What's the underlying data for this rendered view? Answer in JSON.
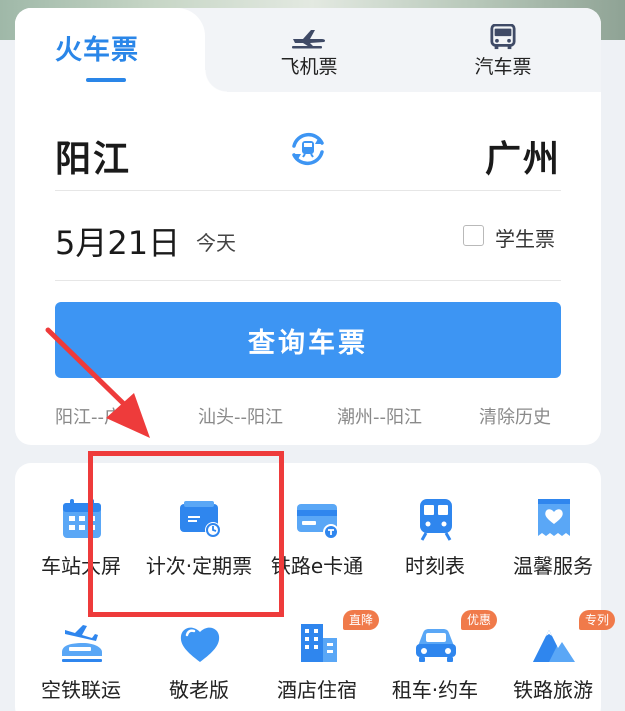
{
  "tabs": {
    "train_label": "火车票",
    "plane_label": "飞机票",
    "bus_label": "汽车票",
    "plane_icon": "airplane-icon",
    "bus_icon": "bus-icon"
  },
  "route": {
    "from": "阳江",
    "to": "广州",
    "swap_icon": "swap-stations-icon"
  },
  "date": {
    "value": "5月21日",
    "sub": "今天"
  },
  "student": {
    "label": "学生票",
    "checked": false
  },
  "search": {
    "label": "查询车票"
  },
  "history": {
    "items": [
      "阳江--广州",
      "汕头--阳江",
      "潮州--阳江"
    ],
    "clear_label": "清除历史"
  },
  "services": {
    "row1": [
      {
        "label": "车站大屏",
        "icon": "calendar-grid-icon"
      },
      {
        "label": "计次·定期票",
        "icon": "card-clock-icon"
      },
      {
        "label": "铁路e卡通",
        "icon": "train-card-icon"
      },
      {
        "label": "时刻表",
        "icon": "train-front-icon"
      },
      {
        "label": "温馨服务",
        "icon": "heart-ticket-icon"
      }
    ],
    "row2": [
      {
        "label": "空铁联运",
        "icon": "plane-train-icon"
      },
      {
        "label": "敬老版",
        "icon": "heart-icon"
      },
      {
        "label": "酒店住宿",
        "icon": "hotel-building-icon",
        "badge": "直降"
      },
      {
        "label": "租车·约车",
        "icon": "car-icon",
        "badge": "优惠"
      },
      {
        "label": "铁路旅游",
        "icon": "mountain-icon",
        "badge": "专列"
      }
    ]
  },
  "colors": {
    "accent": "#3d95f3",
    "tab_active": "#2a86e8",
    "badge": "#f07a4a",
    "annotation": "#ee3b3b"
  }
}
